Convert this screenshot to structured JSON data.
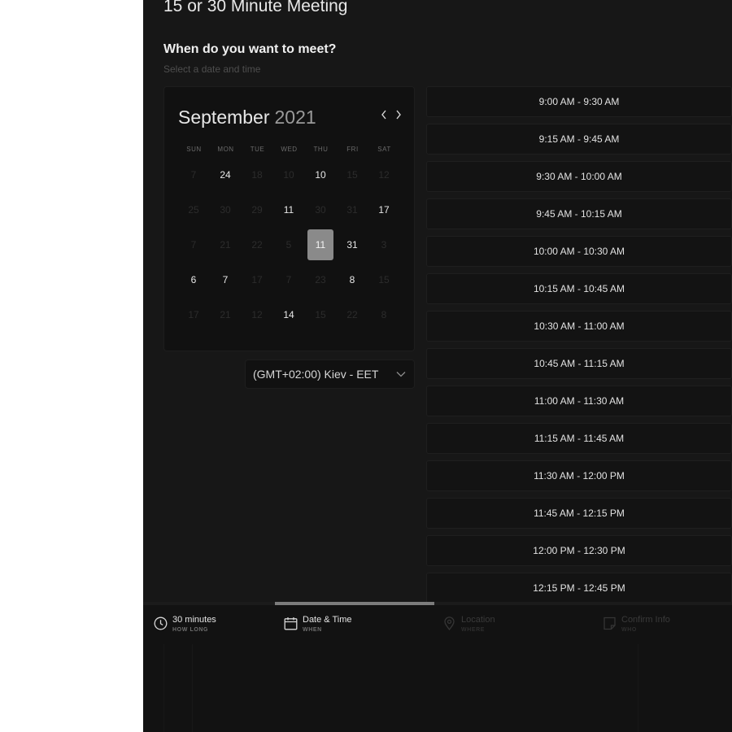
{
  "meeting": {
    "title": "15 or 30 Minute Meeting",
    "question": "When do you want to meet?",
    "subtext": "Select a date and time"
  },
  "calendar": {
    "month": "September",
    "year": "2021",
    "prev_icon": "chevron-left-icon",
    "next_icon": "chevron-right-icon",
    "weekdays": [
      "SUN",
      "MON",
      "TUE",
      "WED",
      "THU",
      "FRI",
      "SAT"
    ],
    "weeks": [
      [
        {
          "d": "7",
          "a": false
        },
        {
          "d": "24",
          "a": true
        },
        {
          "d": "18",
          "a": false
        },
        {
          "d": "10",
          "a": false
        },
        {
          "d": "10",
          "a": true
        },
        {
          "d": "15",
          "a": false
        },
        {
          "d": "12",
          "a": false
        }
      ],
      [
        {
          "d": "25",
          "a": false
        },
        {
          "d": "30",
          "a": false
        },
        {
          "d": "29",
          "a": false
        },
        {
          "d": "11",
          "a": true
        },
        {
          "d": "30",
          "a": false
        },
        {
          "d": "31",
          "a": false
        },
        {
          "d": "17",
          "a": true
        }
      ],
      [
        {
          "d": "7",
          "a": false
        },
        {
          "d": "21",
          "a": false
        },
        {
          "d": "22",
          "a": false
        },
        {
          "d": "5",
          "a": false
        },
        {
          "d": "11",
          "a": true,
          "selected": true
        },
        {
          "d": "31",
          "a": true
        },
        {
          "d": "3",
          "a": false
        }
      ],
      [
        {
          "d": "6",
          "a": true
        },
        {
          "d": "7",
          "a": true
        },
        {
          "d": "17",
          "a": false
        },
        {
          "d": "7",
          "a": false
        },
        {
          "d": "23",
          "a": false
        },
        {
          "d": "8",
          "a": true
        },
        {
          "d": "15",
          "a": false
        }
      ],
      [
        {
          "d": "17",
          "a": false
        },
        {
          "d": "21",
          "a": false
        },
        {
          "d": "12",
          "a": false
        },
        {
          "d": "14",
          "a": true
        },
        {
          "d": "15",
          "a": false
        },
        {
          "d": "22",
          "a": false
        },
        {
          "d": "8",
          "a": false
        }
      ]
    ]
  },
  "timezone": {
    "label": "(GMT+02:00) Kiev - EET",
    "icon": "chevron-down-icon"
  },
  "slots": [
    "9:00 AM - 9:30 AM",
    "9:15 AM - 9:45 AM",
    "9:30 AM - 10:00 AM",
    "9:45 AM - 10:15 AM",
    "10:00 AM - 10:30 AM",
    "10:15 AM - 10:45 AM",
    "10:30 AM - 11:00 AM",
    "10:45 AM - 11:15 AM",
    "11:00 AM - 11:30 AM",
    "11:15 AM - 11:45 AM",
    "11:30 AM - 12:00 PM",
    "11:45 AM - 12:15 PM",
    "12:00 PM - 12:30 PM",
    "12:15 PM - 12:45 PM"
  ],
  "progress": {
    "fraction": 0.5
  },
  "steps": [
    {
      "label": "30 minutes",
      "sub": "HOW LONG",
      "icon": "clock-icon",
      "active": true
    },
    {
      "label": "Date & Time",
      "sub": "WHEN",
      "icon": "calendar-icon",
      "active": true
    },
    {
      "label": "Location",
      "sub": "WHERE",
      "icon": "location-pin-icon",
      "active": false
    },
    {
      "label": "Confirm Info",
      "sub": "WHO",
      "icon": "document-icon",
      "active": false
    }
  ],
  "colors": {
    "panel_bg": "#171717",
    "selected_day": "#8a8a8a",
    "progress_fill": "#7c7c7c"
  }
}
